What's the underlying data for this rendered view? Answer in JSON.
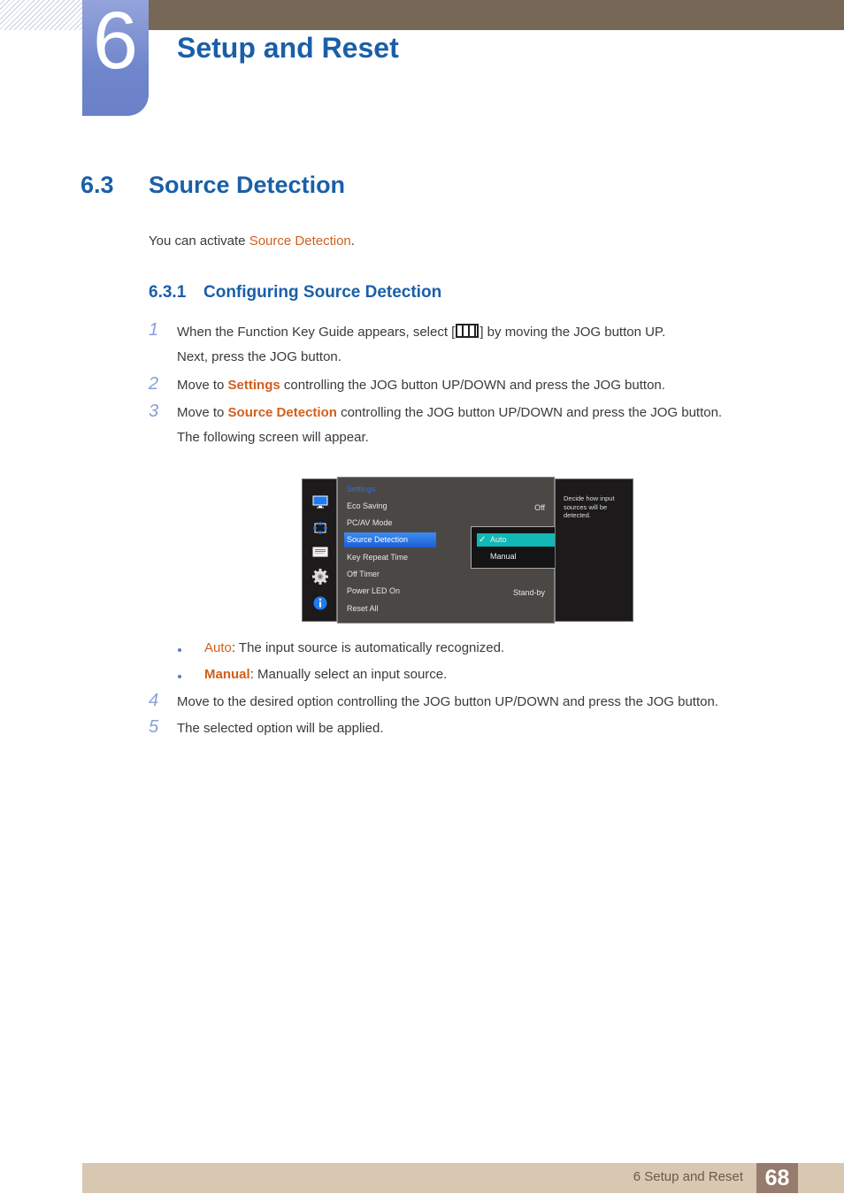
{
  "chapter": {
    "number": "6",
    "title": "Setup and Reset"
  },
  "section": {
    "number": "6.3",
    "title": "Source Detection"
  },
  "intro": {
    "prefix": "You can activate ",
    "highlight": "Source Detection",
    "suffix": "."
  },
  "subsection": {
    "number": "6.3.1",
    "title": "Configuring Source Detection"
  },
  "steps": [
    {
      "num": "1",
      "line1_a": "When the Function Key Guide appears, select [",
      "icon": "menu-icon",
      "line1_b": "] by moving the JOG button UP.",
      "line2": "Next, press the JOG button."
    },
    {
      "num": "2",
      "a": "Move to ",
      "hl": "Settings",
      "b": " controlling the JOG button UP/DOWN and press the JOG button."
    },
    {
      "num": "3",
      "a": "Move to ",
      "hl": "Source Detection",
      "b": " controlling the JOG button UP/DOWN and press the JOG button.",
      "line2": "The following screen will appear."
    },
    {
      "num": "4",
      "text": "Move to the desired option controlling the JOG button UP/DOWN and press the JOG button."
    },
    {
      "num": "5",
      "text": "The selected option will be applied."
    }
  ],
  "bullets": [
    {
      "term": "Auto",
      "desc": ": The input source is automatically recognized."
    },
    {
      "term": "Manual",
      "desc": ": Manually select an input source."
    }
  ],
  "osd": {
    "sidebar_icons": [
      "monitor-icon",
      "size-position-icon",
      "color-bars-icon",
      "gear-icon",
      "info-icon"
    ],
    "title": "Settings",
    "items": [
      {
        "label": "Eco Saving",
        "value": "Off"
      },
      {
        "label": "PC/AV Mode",
        "value": ""
      },
      {
        "label": "Source Detection",
        "value": ""
      },
      {
        "label": "Key Repeat Time",
        "value": ""
      },
      {
        "label": "Off Timer",
        "value": ""
      },
      {
        "label": "Power LED On",
        "value": "Stand-by"
      },
      {
        "label": "Reset All",
        "value": ""
      }
    ],
    "selected_item": "Source Detection",
    "popup_options": [
      "Auto",
      "Manual"
    ],
    "popup_selected": "Auto",
    "help_text": "Decide how input sources will be detected.",
    "colors": {
      "selected_item": "#1a5fd6",
      "selected_option": "#11b8b6",
      "title": "#2c6fe0"
    }
  },
  "footer": {
    "text": "6 Setup and Reset",
    "page": "68"
  },
  "colors": {
    "heading": "#1a5fa8",
    "highlight": "#d15f1f",
    "top_bar": "#766757",
    "footer_bar": "#d8c8b2"
  }
}
